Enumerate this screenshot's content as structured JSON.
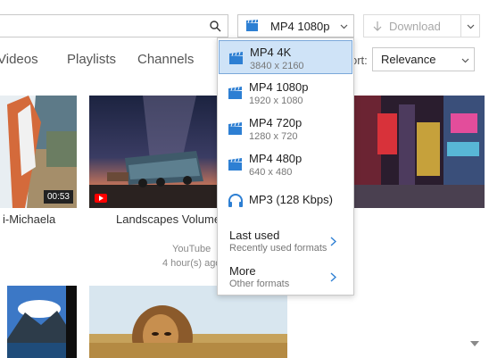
{
  "toolbar": {
    "search_placeholder": "",
    "format_label": "MP4 1080p",
    "download_label": "Download"
  },
  "tabs": [
    "Videos",
    "Playlists",
    "Channels"
  ],
  "sort": {
    "label": "ort:",
    "value": "Relevance"
  },
  "cards": [
    {
      "title": "i-Michaela",
      "duration": "00:53"
    },
    {
      "title": "Landscapes Volume 4",
      "source": "YouTube",
      "age": "4 hour(s) ago"
    }
  ],
  "menu": {
    "items": [
      {
        "title": "MP4 4K",
        "subtitle": "3840 x 2160",
        "icon": "video-icon",
        "selected": true
      },
      {
        "title": "MP4 1080p",
        "subtitle": "1920 x 1080",
        "icon": "video-icon"
      },
      {
        "title": "MP4 720p",
        "subtitle": "1280 x 720",
        "icon": "video-icon"
      },
      {
        "title": "MP4 480p",
        "subtitle": "640 x 480",
        "icon": "video-icon"
      },
      {
        "title": "MP3 (128 Kbps)",
        "subtitle": "",
        "icon": "headphones-icon"
      }
    ],
    "submenus": [
      {
        "title": "Last used",
        "subtitle": "Recently used formats"
      },
      {
        "title": "More",
        "subtitle": "Other formats"
      }
    ]
  },
  "colors": {
    "accent": "#2d7fd3",
    "selected_bg": "#cfe3f7",
    "youtube_red": "#ff0000"
  }
}
